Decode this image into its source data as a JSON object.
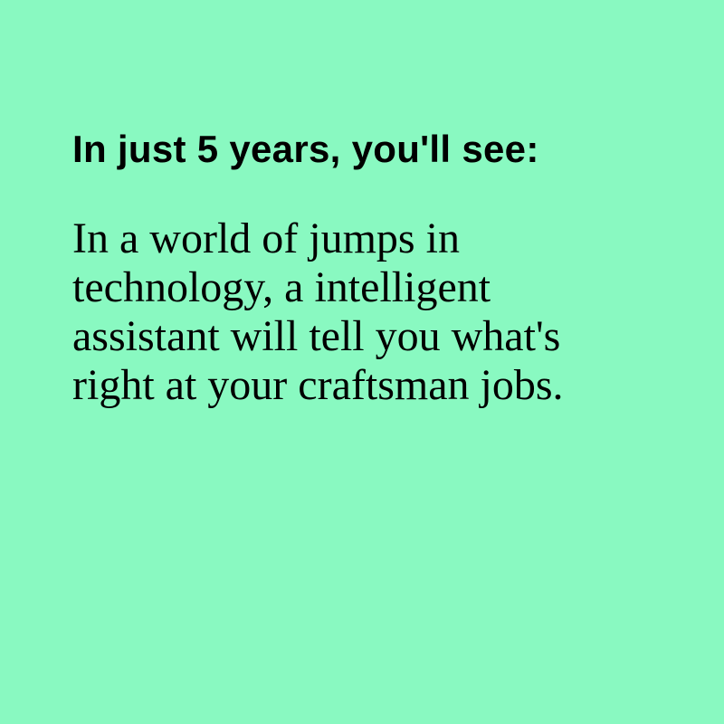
{
  "colors": {
    "background": "#89F9C1",
    "text": "#000000"
  },
  "card": {
    "headline": "In just 5 years, you'll see:",
    "body": "In a world of jumps in technology, a intelligent assistant will tell you what's right at your craftsman jobs."
  }
}
